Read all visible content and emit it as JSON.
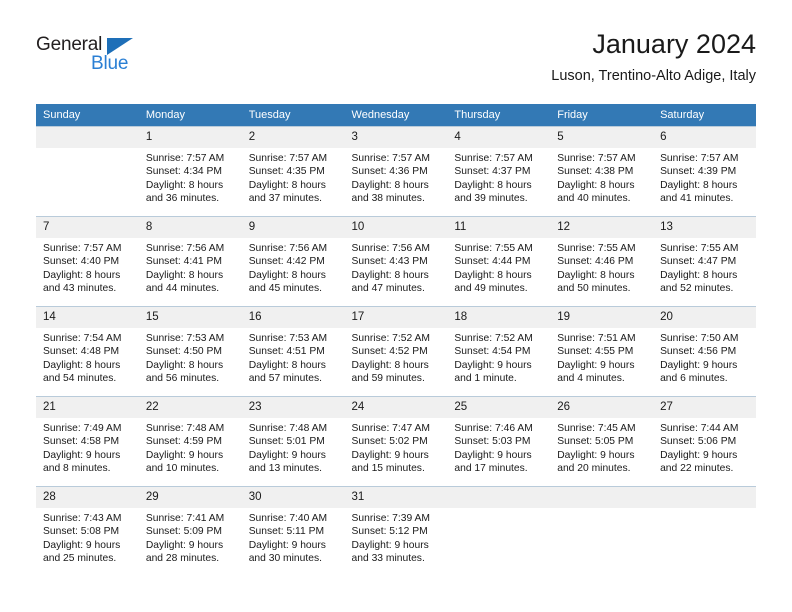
{
  "logo": {
    "word_top": "General",
    "word_bottom": "Blue",
    "triangle_color": "#1e6fb8",
    "blue_color": "#2a7fd4"
  },
  "header": {
    "title": "January 2024",
    "subtitle": "Luson, Trentino-Alto Adige, Italy"
  },
  "calendar": {
    "header_bg": "#3379b5",
    "daynum_bg": "#f0f0f0",
    "weekday_headers": [
      "Sunday",
      "Monday",
      "Tuesday",
      "Wednesday",
      "Thursday",
      "Friday",
      "Saturday"
    ],
    "weeks": [
      [
        {
          "day": "",
          "sunrise": "",
          "sunset": "",
          "daylight1": "",
          "daylight2": ""
        },
        {
          "day": "1",
          "sunrise": "Sunrise: 7:57 AM",
          "sunset": "Sunset: 4:34 PM",
          "daylight1": "Daylight: 8 hours",
          "daylight2": "and 36 minutes."
        },
        {
          "day": "2",
          "sunrise": "Sunrise: 7:57 AM",
          "sunset": "Sunset: 4:35 PM",
          "daylight1": "Daylight: 8 hours",
          "daylight2": "and 37 minutes."
        },
        {
          "day": "3",
          "sunrise": "Sunrise: 7:57 AM",
          "sunset": "Sunset: 4:36 PM",
          "daylight1": "Daylight: 8 hours",
          "daylight2": "and 38 minutes."
        },
        {
          "day": "4",
          "sunrise": "Sunrise: 7:57 AM",
          "sunset": "Sunset: 4:37 PM",
          "daylight1": "Daylight: 8 hours",
          "daylight2": "and 39 minutes."
        },
        {
          "day": "5",
          "sunrise": "Sunrise: 7:57 AM",
          "sunset": "Sunset: 4:38 PM",
          "daylight1": "Daylight: 8 hours",
          "daylight2": "and 40 minutes."
        },
        {
          "day": "6",
          "sunrise": "Sunrise: 7:57 AM",
          "sunset": "Sunset: 4:39 PM",
          "daylight1": "Daylight: 8 hours",
          "daylight2": "and 41 minutes."
        }
      ],
      [
        {
          "day": "7",
          "sunrise": "Sunrise: 7:57 AM",
          "sunset": "Sunset: 4:40 PM",
          "daylight1": "Daylight: 8 hours",
          "daylight2": "and 43 minutes."
        },
        {
          "day": "8",
          "sunrise": "Sunrise: 7:56 AM",
          "sunset": "Sunset: 4:41 PM",
          "daylight1": "Daylight: 8 hours",
          "daylight2": "and 44 minutes."
        },
        {
          "day": "9",
          "sunrise": "Sunrise: 7:56 AM",
          "sunset": "Sunset: 4:42 PM",
          "daylight1": "Daylight: 8 hours",
          "daylight2": "and 45 minutes."
        },
        {
          "day": "10",
          "sunrise": "Sunrise: 7:56 AM",
          "sunset": "Sunset: 4:43 PM",
          "daylight1": "Daylight: 8 hours",
          "daylight2": "and 47 minutes."
        },
        {
          "day": "11",
          "sunrise": "Sunrise: 7:55 AM",
          "sunset": "Sunset: 4:44 PM",
          "daylight1": "Daylight: 8 hours",
          "daylight2": "and 49 minutes."
        },
        {
          "day": "12",
          "sunrise": "Sunrise: 7:55 AM",
          "sunset": "Sunset: 4:46 PM",
          "daylight1": "Daylight: 8 hours",
          "daylight2": "and 50 minutes."
        },
        {
          "day": "13",
          "sunrise": "Sunrise: 7:55 AM",
          "sunset": "Sunset: 4:47 PM",
          "daylight1": "Daylight: 8 hours",
          "daylight2": "and 52 minutes."
        }
      ],
      [
        {
          "day": "14",
          "sunrise": "Sunrise: 7:54 AM",
          "sunset": "Sunset: 4:48 PM",
          "daylight1": "Daylight: 8 hours",
          "daylight2": "and 54 minutes."
        },
        {
          "day": "15",
          "sunrise": "Sunrise: 7:53 AM",
          "sunset": "Sunset: 4:50 PM",
          "daylight1": "Daylight: 8 hours",
          "daylight2": "and 56 minutes."
        },
        {
          "day": "16",
          "sunrise": "Sunrise: 7:53 AM",
          "sunset": "Sunset: 4:51 PM",
          "daylight1": "Daylight: 8 hours",
          "daylight2": "and 57 minutes."
        },
        {
          "day": "17",
          "sunrise": "Sunrise: 7:52 AM",
          "sunset": "Sunset: 4:52 PM",
          "daylight1": "Daylight: 8 hours",
          "daylight2": "and 59 minutes."
        },
        {
          "day": "18",
          "sunrise": "Sunrise: 7:52 AM",
          "sunset": "Sunset: 4:54 PM",
          "daylight1": "Daylight: 9 hours",
          "daylight2": "and 1 minute."
        },
        {
          "day": "19",
          "sunrise": "Sunrise: 7:51 AM",
          "sunset": "Sunset: 4:55 PM",
          "daylight1": "Daylight: 9 hours",
          "daylight2": "and 4 minutes."
        },
        {
          "day": "20",
          "sunrise": "Sunrise: 7:50 AM",
          "sunset": "Sunset: 4:56 PM",
          "daylight1": "Daylight: 9 hours",
          "daylight2": "and 6 minutes."
        }
      ],
      [
        {
          "day": "21",
          "sunrise": "Sunrise: 7:49 AM",
          "sunset": "Sunset: 4:58 PM",
          "daylight1": "Daylight: 9 hours",
          "daylight2": "and 8 minutes."
        },
        {
          "day": "22",
          "sunrise": "Sunrise: 7:48 AM",
          "sunset": "Sunset: 4:59 PM",
          "daylight1": "Daylight: 9 hours",
          "daylight2": "and 10 minutes."
        },
        {
          "day": "23",
          "sunrise": "Sunrise: 7:48 AM",
          "sunset": "Sunset: 5:01 PM",
          "daylight1": "Daylight: 9 hours",
          "daylight2": "and 13 minutes."
        },
        {
          "day": "24",
          "sunrise": "Sunrise: 7:47 AM",
          "sunset": "Sunset: 5:02 PM",
          "daylight1": "Daylight: 9 hours",
          "daylight2": "and 15 minutes."
        },
        {
          "day": "25",
          "sunrise": "Sunrise: 7:46 AM",
          "sunset": "Sunset: 5:03 PM",
          "daylight1": "Daylight: 9 hours",
          "daylight2": "and 17 minutes."
        },
        {
          "day": "26",
          "sunrise": "Sunrise: 7:45 AM",
          "sunset": "Sunset: 5:05 PM",
          "daylight1": "Daylight: 9 hours",
          "daylight2": "and 20 minutes."
        },
        {
          "day": "27",
          "sunrise": "Sunrise: 7:44 AM",
          "sunset": "Sunset: 5:06 PM",
          "daylight1": "Daylight: 9 hours",
          "daylight2": "and 22 minutes."
        }
      ],
      [
        {
          "day": "28",
          "sunrise": "Sunrise: 7:43 AM",
          "sunset": "Sunset: 5:08 PM",
          "daylight1": "Daylight: 9 hours",
          "daylight2": "and 25 minutes."
        },
        {
          "day": "29",
          "sunrise": "Sunrise: 7:41 AM",
          "sunset": "Sunset: 5:09 PM",
          "daylight1": "Daylight: 9 hours",
          "daylight2": "and 28 minutes."
        },
        {
          "day": "30",
          "sunrise": "Sunrise: 7:40 AM",
          "sunset": "Sunset: 5:11 PM",
          "daylight1": "Daylight: 9 hours",
          "daylight2": "and 30 minutes."
        },
        {
          "day": "31",
          "sunrise": "Sunrise: 7:39 AM",
          "sunset": "Sunset: 5:12 PM",
          "daylight1": "Daylight: 9 hours",
          "daylight2": "and 33 minutes."
        },
        {
          "day": "",
          "sunrise": "",
          "sunset": "",
          "daylight1": "",
          "daylight2": ""
        },
        {
          "day": "",
          "sunrise": "",
          "sunset": "",
          "daylight1": "",
          "daylight2": ""
        },
        {
          "day": "",
          "sunrise": "",
          "sunset": "",
          "daylight1": "",
          "daylight2": ""
        }
      ]
    ]
  }
}
